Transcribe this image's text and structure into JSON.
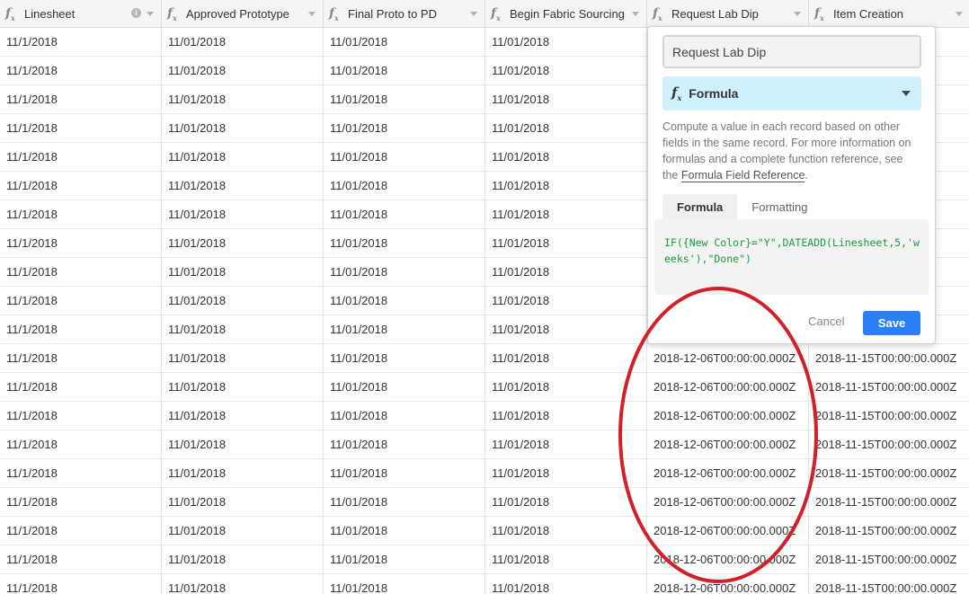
{
  "columns": [
    {
      "name": "Linesheet",
      "icon": "formula-icon",
      "has_info": true
    },
    {
      "name": "Approved Prototype",
      "icon": "formula-icon",
      "has_info": false
    },
    {
      "name": "Final Proto to PD",
      "icon": "formula-icon",
      "has_info": false
    },
    {
      "name": "Begin Fabric Sourcing",
      "icon": "formula-icon",
      "has_info": false
    },
    {
      "name": "Request Lab Dip",
      "icon": "formula-icon",
      "has_info": false
    },
    {
      "name": "Item Creation",
      "icon": "formula-icon",
      "has_info": false
    }
  ],
  "rows": [
    [
      "11/1/2018",
      "11/01/2018",
      "11/01/2018",
      "11/01/2018",
      "",
      ""
    ],
    [
      "11/1/2018",
      "11/01/2018",
      "11/01/2018",
      "11/01/2018",
      "",
      ""
    ],
    [
      "11/1/2018",
      "11/01/2018",
      "11/01/2018",
      "11/01/2018",
      "",
      ""
    ],
    [
      "11/1/2018",
      "11/01/2018",
      "11/01/2018",
      "11/01/2018",
      "",
      ""
    ],
    [
      "11/1/2018",
      "11/01/2018",
      "11/01/2018",
      "11/01/2018",
      "",
      ""
    ],
    [
      "11/1/2018",
      "11/01/2018",
      "11/01/2018",
      "11/01/2018",
      "",
      ""
    ],
    [
      "11/1/2018",
      "11/01/2018",
      "11/01/2018",
      "11/01/2018",
      "",
      ""
    ],
    [
      "11/1/2018",
      "11/01/2018",
      "11/01/2018",
      "11/01/2018",
      "",
      ""
    ],
    [
      "11/1/2018",
      "11/01/2018",
      "11/01/2018",
      "11/01/2018",
      "",
      ""
    ],
    [
      "11/1/2018",
      "11/01/2018",
      "11/01/2018",
      "11/01/2018",
      "",
      ""
    ],
    [
      "11/1/2018",
      "11/01/2018",
      "11/01/2018",
      "11/01/2018",
      "",
      ""
    ],
    [
      "11/1/2018",
      "11/01/2018",
      "11/01/2018",
      "11/01/2018",
      "2018-12-06T00:00:00.000Z",
      "2018-11-15T00:00:00.000Z"
    ],
    [
      "11/1/2018",
      "11/01/2018",
      "11/01/2018",
      "11/01/2018",
      "2018-12-06T00:00:00.000Z",
      "2018-11-15T00:00:00.000Z"
    ],
    [
      "11/1/2018",
      "11/01/2018",
      "11/01/2018",
      "11/01/2018",
      "2018-12-06T00:00:00.000Z",
      "2018-11-15T00:00:00.000Z"
    ],
    [
      "11/1/2018",
      "11/01/2018",
      "11/01/2018",
      "11/01/2018",
      "2018-12-06T00:00:00.000Z",
      "2018-11-15T00:00:00.000Z"
    ],
    [
      "11/1/2018",
      "11/01/2018",
      "11/01/2018",
      "11/01/2018",
      "2018-12-06T00:00:00.000Z",
      "2018-11-15T00:00:00.000Z"
    ],
    [
      "11/1/2018",
      "11/01/2018",
      "11/01/2018",
      "11/01/2018",
      "2018-12-06T00:00:00.000Z",
      "2018-11-15T00:00:00.000Z"
    ],
    [
      "11/1/2018",
      "11/01/2018",
      "11/01/2018",
      "11/01/2018",
      "2018-12-06T00:00:00.000Z",
      "2018-11-15T00:00:00.000Z"
    ],
    [
      "11/1/2018",
      "11/01/2018",
      "11/01/2018",
      "11/01/2018",
      "2018-12-06T00:00:00.000Z",
      "2018-11-15T00:00:00.000Z"
    ],
    [
      "11/1/2018",
      "11/01/2018",
      "11/01/2018",
      "11/01/2018",
      "2018-12-06T00:00:00.000Z",
      "2018-11-15T00:00:00.000Z"
    ]
  ],
  "field_editor": {
    "field_name": "Request Lab Dip",
    "type_label": "Formula",
    "type_icon": "formula-icon",
    "description_text": "Compute a value in each record based on other fields in the same record. For more information on formulas and a complete function reference, see the ",
    "description_link": "Formula Field Reference",
    "description_end": ".",
    "tabs": [
      {
        "label": "Formula",
        "active": true
      },
      {
        "label": "Formatting",
        "active": false
      }
    ],
    "formula": "IF({New Color}=\"Y\",DATEADD(Linesheet,5,'weeks'),\"Done\")",
    "cancel_label": "Cancel",
    "save_label": "Save"
  },
  "colors": {
    "header_bg": "#f5f5f5",
    "type_select_bg": "#d0f0fd",
    "formula_text": "#1b9e3e",
    "save_button": "#2d7ff9",
    "annotation_circle": "#d0202a"
  }
}
